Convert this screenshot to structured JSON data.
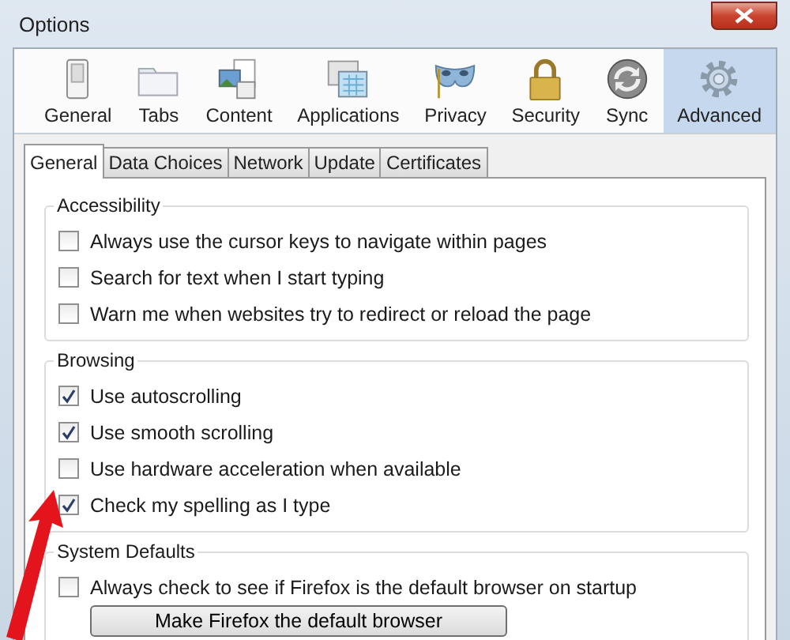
{
  "window": {
    "title": "Options"
  },
  "toolbar": [
    {
      "label": "General",
      "selected": false
    },
    {
      "label": "Tabs",
      "selected": false
    },
    {
      "label": "Content",
      "selected": false
    },
    {
      "label": "Applications",
      "selected": false
    },
    {
      "label": "Privacy",
      "selected": false
    },
    {
      "label": "Security",
      "selected": false
    },
    {
      "label": "Sync",
      "selected": false
    },
    {
      "label": "Advanced",
      "selected": true
    }
  ],
  "tabs": [
    {
      "label": "General",
      "selected": true
    },
    {
      "label": "Data Choices",
      "selected": false
    },
    {
      "label": "Network",
      "selected": false
    },
    {
      "label": "Update",
      "selected": false
    },
    {
      "label": "Certificates",
      "selected": false
    }
  ],
  "groups": [
    {
      "title": "Accessibility",
      "options": [
        {
          "label": "Always use the cursor keys to navigate within pages",
          "checked": false
        },
        {
          "label": "Search for text when I start typing",
          "checked": false
        },
        {
          "label": "Warn me when websites try to redirect or reload the page",
          "checked": false
        }
      ]
    },
    {
      "title": "Browsing",
      "options": [
        {
          "label": "Use autoscrolling",
          "checked": true
        },
        {
          "label": "Use smooth scrolling",
          "checked": true
        },
        {
          "label": "Use hardware acceleration when available",
          "checked": false
        },
        {
          "label": "Check my spelling as I type",
          "checked": true
        }
      ]
    },
    {
      "title": "System Defaults",
      "options": [
        {
          "label": "Always check to see if Firefox is the default browser on startup",
          "checked": false
        }
      ],
      "button": "Make Firefox the default browser"
    }
  ]
}
